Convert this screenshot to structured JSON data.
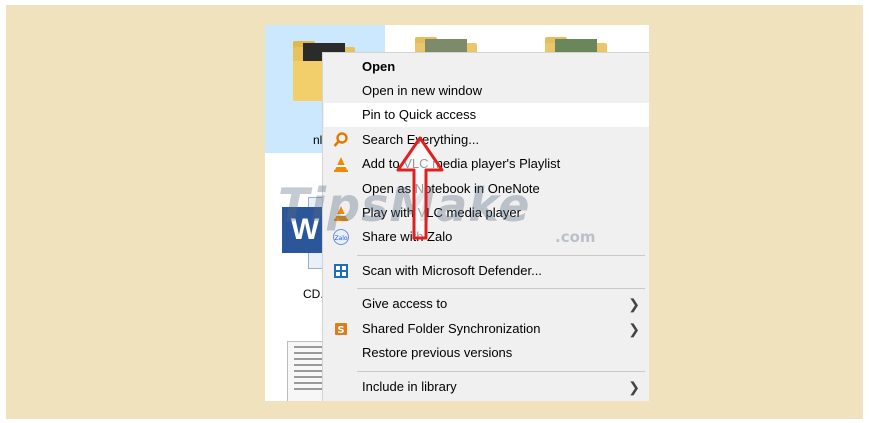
{
  "explorer": {
    "folder_label": "nl",
    "word_file_label": "CD.",
    "word_icon_letter": "W"
  },
  "context_menu": {
    "items": [
      {
        "label": "Open",
        "bold": true,
        "icon": null
      },
      {
        "label": "Open in new window",
        "icon": null
      },
      {
        "label": "Pin to Quick access",
        "icon": null,
        "highlighted": true
      },
      {
        "label": "Search Everything...",
        "icon": "search-everything-icon"
      },
      {
        "label": "Add to VLC media player's Playlist",
        "icon": "vlc-icon"
      },
      {
        "label": "Open as Notebook in OneNote",
        "icon": null
      },
      {
        "label": "Play with VLC media player",
        "icon": "vlc-icon"
      },
      {
        "label": "Share with Zalo",
        "icon": "zalo-icon"
      },
      {
        "label": "Scan with Microsoft Defender...",
        "icon": "defender-shield-icon"
      },
      {
        "label": "Give access to",
        "icon": null,
        "submenu": true
      },
      {
        "label": "Shared Folder Synchronization",
        "icon": "sync-icon",
        "submenu": true
      },
      {
        "label": "Restore previous versions",
        "icon": null
      },
      {
        "label": "Include in library",
        "icon": null,
        "submenu": true
      }
    ]
  },
  "watermark": {
    "brand": "TipsMake",
    "domain": ".com"
  },
  "colors": {
    "frame": "#efe2bd",
    "selection": "#cce8ff",
    "menu_bg": "#f0f0f0",
    "arrow": "#e02020",
    "vlc": "#f08a00",
    "word": "#2b579a"
  }
}
